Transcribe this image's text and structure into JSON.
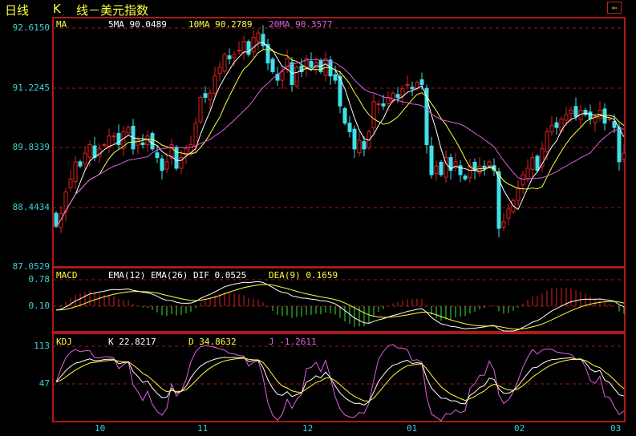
{
  "header": {
    "period": "日线",
    "k": "K",
    "title": "线－美元指数",
    "back_icon": "back-arrow-icon"
  },
  "colors": {
    "up": "#e02020",
    "down": "#40e0e8",
    "ma5": "#ffffff",
    "ma10": "#ffff40",
    "ma20": "#e060e0",
    "grid": "#a01818",
    "axis_text": "#40d0d8"
  },
  "ma_panel": {
    "name": "MA",
    "ma5": "5MA 90.0489",
    "ma10": "10MA 90.2789",
    "ma20": "20MA 90.3577",
    "ticks": [
      "92.6150",
      "91.2245",
      "89.8339",
      "88.4434",
      "87.0529"
    ]
  },
  "macd_panel": {
    "name": "MACD",
    "ema": "EMA(12) EMA(26) DIF 0.0525",
    "dea": "DEA(9) 0.1659",
    "ticks": [
      "0.78",
      "0.10"
    ]
  },
  "kdj_panel": {
    "name": "KDJ",
    "k": "K 22.8217",
    "d": "D 34.8632",
    "j": "J -1.2611",
    "ticks": [
      "113",
      "47"
    ]
  },
  "x_ticks": [
    "10",
    "11",
    "12",
    "01",
    "02",
    "03"
  ],
  "chart_data": {
    "type": "candlestick",
    "title": "K 线－美元指数",
    "ylim": [
      87.0529,
      92.615
    ],
    "macd_ylim": [
      -0.56,
      1.09
    ],
    "kdj_ylim": [
      -19,
      135
    ],
    "x_tick_index": [
      9,
      31,
      53,
      75,
      97,
      117
    ],
    "close": [
      88.0,
      88.3,
      88.8,
      89.1,
      89.5,
      89.4,
      89.7,
      89.9,
      89.6,
      89.8,
      89.9,
      90.1,
      90.1,
      89.9,
      90.2,
      90.3,
      89.8,
      90.0,
      89.9,
      90.1,
      89.8,
      89.6,
      89.3,
      89.5,
      89.9,
      89.35,
      89.6,
      89.8,
      89.9,
      90.4,
      91.0,
      91.0,
      91.1,
      91.5,
      91.7,
      92.0,
      91.9,
      92.0,
      92.1,
      92.3,
      92.0,
      92.4,
      92.5,
      92.2,
      91.8,
      91.6,
      91.4,
      91.6,
      91.9,
      91.3,
      91.7,
      91.6,
      91.9,
      91.7,
      91.8,
      91.6,
      91.9,
      91.5,
      91.4,
      90.8,
      90.4,
      90.2,
      89.8,
      90.0,
      89.8,
      90.2,
      90.9,
      90.85,
      90.8,
      91.0,
      91.1,
      91.0,
      91.2,
      91.3,
      91.2,
      91.35,
      91.3,
      89.9,
      89.2,
      89.4,
      89.2,
      89.6,
      89.3,
      89.5,
      89.2,
      89.1,
      89.4,
      89.3,
      89.4,
      89.35,
      89.5,
      89.3,
      87.95,
      88.1,
      88.4,
      88.6,
      88.9,
      89.2,
      89.35,
      89.6,
      89.3,
      89.8,
      90.2,
      90.35,
      90.3,
      90.5,
      90.6,
      90.7,
      90.55,
      90.7,
      90.6,
      90.5,
      90.55,
      90.7,
      90.4,
      90.5,
      90.3,
      89.5,
      89.7
    ]
  }
}
